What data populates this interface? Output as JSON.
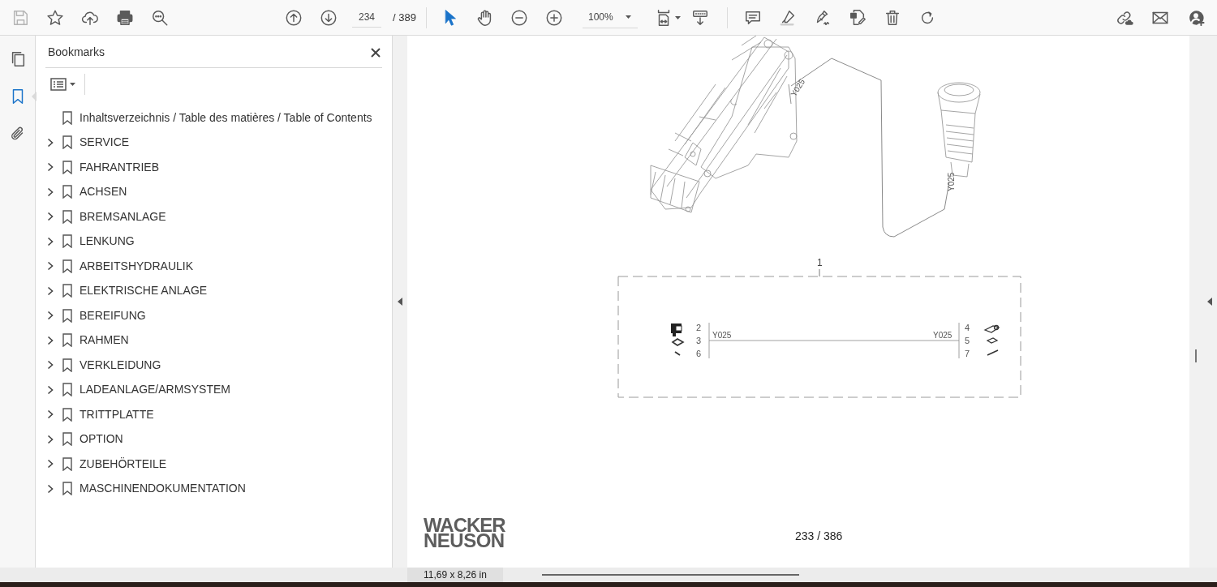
{
  "toolbar": {
    "save": {
      "disabled": true
    },
    "page_input": "234",
    "page_total": "/ 389",
    "zoom": "100%"
  },
  "nav_panels": [
    {
      "kind": "pages",
      "selected": false
    },
    {
      "kind": "bookmarks",
      "selected": true
    },
    {
      "kind": "attachments",
      "selected": false
    }
  ],
  "bookmarks": {
    "title": "Bookmarks",
    "items": [
      {
        "label": "Inhaltsverzeichnis / Table des matières / Table of Contents",
        "expandable": false
      },
      {
        "label": "SERVICE",
        "expandable": true
      },
      {
        "label": "FAHRANTRIEB",
        "expandable": true
      },
      {
        "label": "ACHSEN",
        "expandable": true
      },
      {
        "label": "BREMSANLAGE",
        "expandable": true
      },
      {
        "label": "LENKUNG",
        "expandable": true
      },
      {
        "label": "ARBEITSHYDRAULIK",
        "expandable": true
      },
      {
        "label": "ELEKTRISCHE ANLAGE",
        "expandable": true
      },
      {
        "label": "BEREIFUNG",
        "expandable": true
      },
      {
        "label": "RAHMEN",
        "expandable": true
      },
      {
        "label": "VERKLEIDUNG",
        "expandable": true
      },
      {
        "label": "LADEANLAGE/ARMSYSTEM",
        "expandable": true
      },
      {
        "label": "TRITTPLATTE",
        "expandable": true
      },
      {
        "label": "OPTION",
        "expandable": true
      },
      {
        "label": "ZUBEHÖRTEILE",
        "expandable": true
      },
      {
        "label": "MASCHINENDOKUMENTATION",
        "expandable": true
      }
    ]
  },
  "document": {
    "drawing_labels": [
      "Y025",
      "Y025"
    ],
    "schematic": {
      "callout": "1",
      "left_numbers": [
        "2",
        "3",
        "6"
      ],
      "right_numbers": [
        "4",
        "5",
        "7"
      ],
      "left_wire_label": "Y025",
      "right_wire_label": "Y025"
    },
    "logo": [
      "WACKER",
      "NEUSON"
    ],
    "page_label": "233 / 386"
  },
  "status_bar": {
    "page_size": "11,69 x 8,26 in"
  }
}
